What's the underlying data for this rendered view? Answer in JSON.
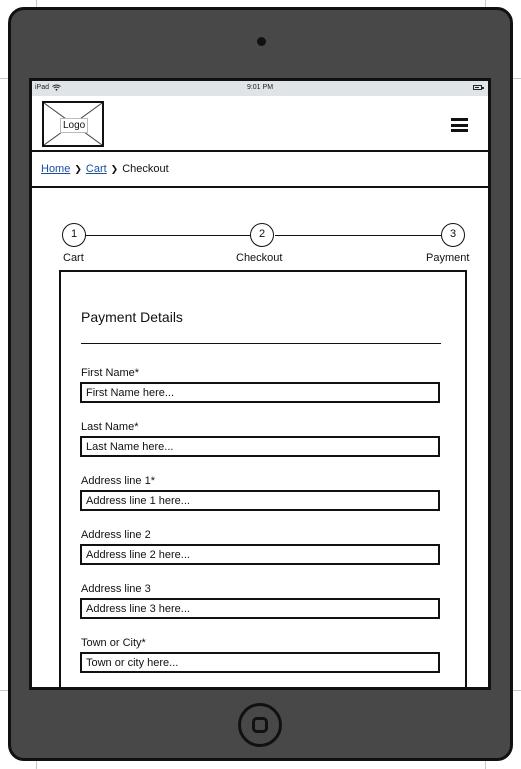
{
  "status_bar": {
    "device": "iPad",
    "time": "9:01 PM"
  },
  "header": {
    "logo_label": "Logo"
  },
  "breadcrumb": {
    "home": "Home",
    "cart": "Cart",
    "current": "Checkout"
  },
  "stepper": {
    "steps": [
      {
        "number": "1",
        "label": "Cart"
      },
      {
        "number": "2",
        "label": "Checkout"
      },
      {
        "number": "3",
        "label": "Payment"
      }
    ]
  },
  "form": {
    "title": "Payment Details",
    "fields": [
      {
        "label": "First Name*",
        "placeholder": "First Name here..."
      },
      {
        "label": "Last Name*",
        "placeholder": "Last Name here..."
      },
      {
        "label": "Address line 1*",
        "placeholder": "Address line 1 here..."
      },
      {
        "label": "Address line 2",
        "placeholder": "Address line 2 here..."
      },
      {
        "label": "Address line 3",
        "placeholder": "Address line 3 here..."
      },
      {
        "label": "Town or City*",
        "placeholder": "Town or city here..."
      }
    ]
  },
  "colors": {
    "device": "#484848",
    "status_bar": "#dfe4e6",
    "link": "#1a4fa0"
  },
  "icons": [
    "wifi-icon",
    "battery-icon",
    "hamburger-menu-icon",
    "home-button-icon",
    "camera-icon",
    "chevron-right-icon"
  ]
}
